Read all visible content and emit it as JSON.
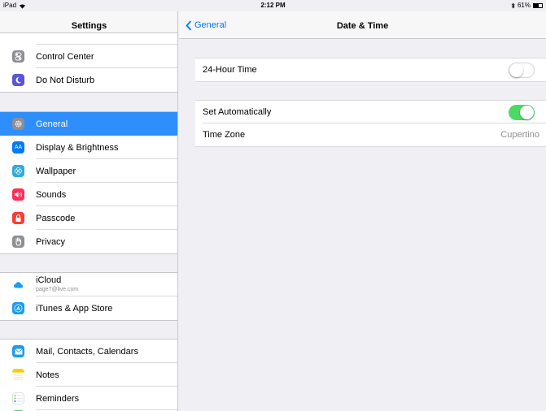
{
  "status_bar": {
    "device": "iPad",
    "time": "2:12 PM",
    "battery": "61%",
    "battery_level": 0.61
  },
  "master": {
    "title": "Settings",
    "groups": [
      {
        "items": [
          {
            "label": "Control Center",
            "icon": "control-center-icon",
            "color": "#8e8e93"
          },
          {
            "label": "Do Not Disturb",
            "icon": "moon-icon",
            "color": "#5856d6"
          }
        ]
      },
      {
        "items": [
          {
            "label": "General",
            "icon": "gear-icon",
            "color": "#8e8e93",
            "selected": true
          },
          {
            "label": "Display & Brightness",
            "icon": "aa-icon",
            "color": "#007aff"
          },
          {
            "label": "Wallpaper",
            "icon": "flower-icon",
            "color": "#34aadc"
          },
          {
            "label": "Sounds",
            "icon": "speaker-icon",
            "color": "#ff2d55"
          },
          {
            "label": "Passcode",
            "icon": "lock-icon",
            "color": "#ff3b30"
          },
          {
            "label": "Privacy",
            "icon": "hand-icon",
            "color": "#8e8e93"
          }
        ]
      },
      {
        "items": [
          {
            "label": "iCloud",
            "sublabel": "page7@live.com",
            "icon": "cloud-icon",
            "color": "#ffffff"
          },
          {
            "label": "iTunes & App Store",
            "icon": "app-store-icon",
            "color": "#1a9bf4"
          }
        ]
      },
      {
        "items": [
          {
            "label": "Mail, Contacts, Calendars",
            "icon": "mail-icon",
            "color": "#1a9bf4"
          },
          {
            "label": "Notes",
            "icon": "notes-icon",
            "color": "#ffcc00"
          },
          {
            "label": "Reminders",
            "icon": "reminders-icon",
            "color": "#ffffff"
          }
        ]
      }
    ]
  },
  "detail": {
    "back_label": "General",
    "title": "Date & Time",
    "hour24": {
      "label": "24-Hour Time",
      "on": false
    },
    "set_auto": {
      "label": "Set Automatically",
      "on": true
    },
    "time_zone": {
      "label": "Time Zone",
      "value": "Cupertino"
    }
  },
  "colors": {
    "accent": "#007aff",
    "selected_row": "#2e8efb",
    "switch_on": "#4cd964"
  }
}
